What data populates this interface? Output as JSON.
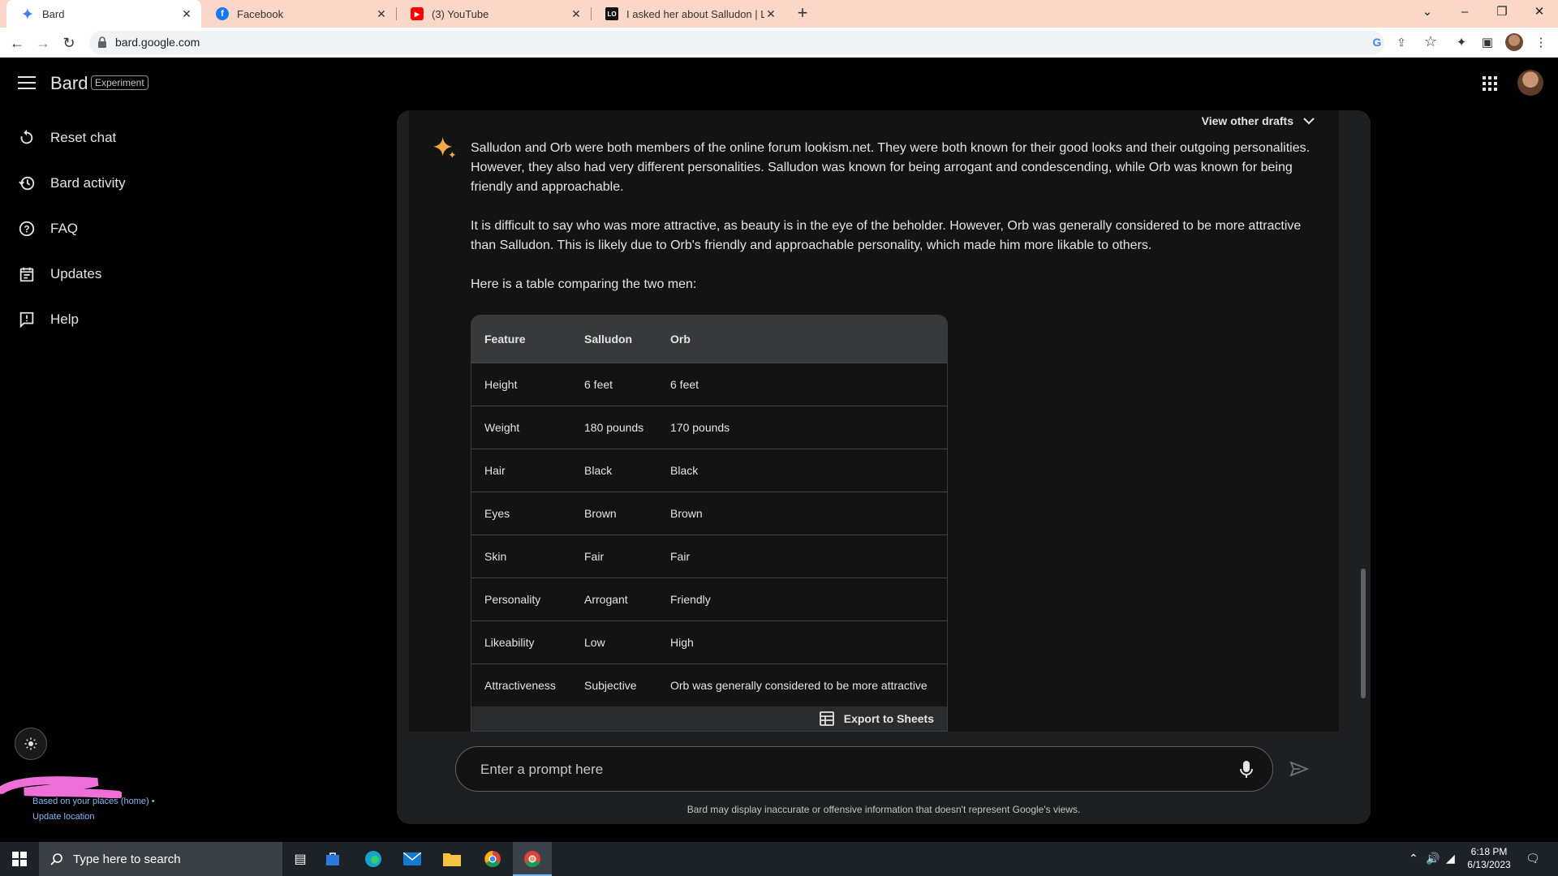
{
  "browser": {
    "tabs": [
      {
        "title": "Bard",
        "icon": "bard-sparkle-icon",
        "active": true
      },
      {
        "title": "Facebook",
        "icon": "facebook-icon",
        "active": false
      },
      {
        "title": "(3) YouTube",
        "icon": "youtube-icon",
        "active": false
      },
      {
        "title": "I asked her about Salludon | Looki",
        "icon": "lookism-icon",
        "active": false
      }
    ],
    "url": "bard.google.com"
  },
  "app": {
    "brand": "Bard",
    "badge": "Experiment",
    "nav": [
      {
        "label": "Reset chat",
        "icon": "reset-icon"
      },
      {
        "label": "Bard activity",
        "icon": "history-icon"
      },
      {
        "label": "FAQ",
        "icon": "help-circle-icon"
      },
      {
        "label": "Updates",
        "icon": "calendar-icon"
      },
      {
        "label": "Help",
        "icon": "feedback-icon"
      }
    ],
    "location": {
      "text": "Based on your places (home)",
      "separator": "•",
      "update": "Update location"
    }
  },
  "response": {
    "view_drafts": "View other drafts",
    "paragraphs": [
      "Salludon and Orb were both members of the online forum lookism.net. They were both known for their good looks and their outgoing personalities. However, they also had very different personalities. Salludon was known for being arrogant and condescending, while Orb was known for being friendly and approachable.",
      "It is difficult to say who was more attractive, as beauty is in the eye of the beholder. However, Orb was generally considered to be more attractive than Salludon. This is likely due to Orb's friendly and approachable personality, which made him more likable to others.",
      "Here is a table comparing the two men:"
    ],
    "table": {
      "headers": [
        "Feature",
        "Salludon",
        "Orb"
      ],
      "rows": [
        [
          "Height",
          "6 feet",
          "6 feet"
        ],
        [
          "Weight",
          "180 pounds",
          "170 pounds"
        ],
        [
          "Hair",
          "Black",
          "Black"
        ],
        [
          "Eyes",
          "Brown",
          "Brown"
        ],
        [
          "Skin",
          "Fair",
          "Fair"
        ],
        [
          "Personality",
          "Arrogant",
          "Friendly"
        ],
        [
          "Likeability",
          "Low",
          "High"
        ],
        [
          "Attractiveness",
          "Subjective",
          "Orb was generally considered to be more attractive"
        ]
      ]
    },
    "export_label": "Export to Sheets"
  },
  "prompt": {
    "placeholder": "Enter a prompt here",
    "disclaimer": "Bard may display inaccurate or offensive information that doesn't represent Google's views."
  },
  "taskbar": {
    "search_placeholder": "Type here to search",
    "time": "6:18 PM",
    "date": "6/13/2023"
  },
  "colors": {
    "accent": "#8ab4f8",
    "tabstrip": "#fad7c8",
    "panel": "#1e1f20"
  }
}
